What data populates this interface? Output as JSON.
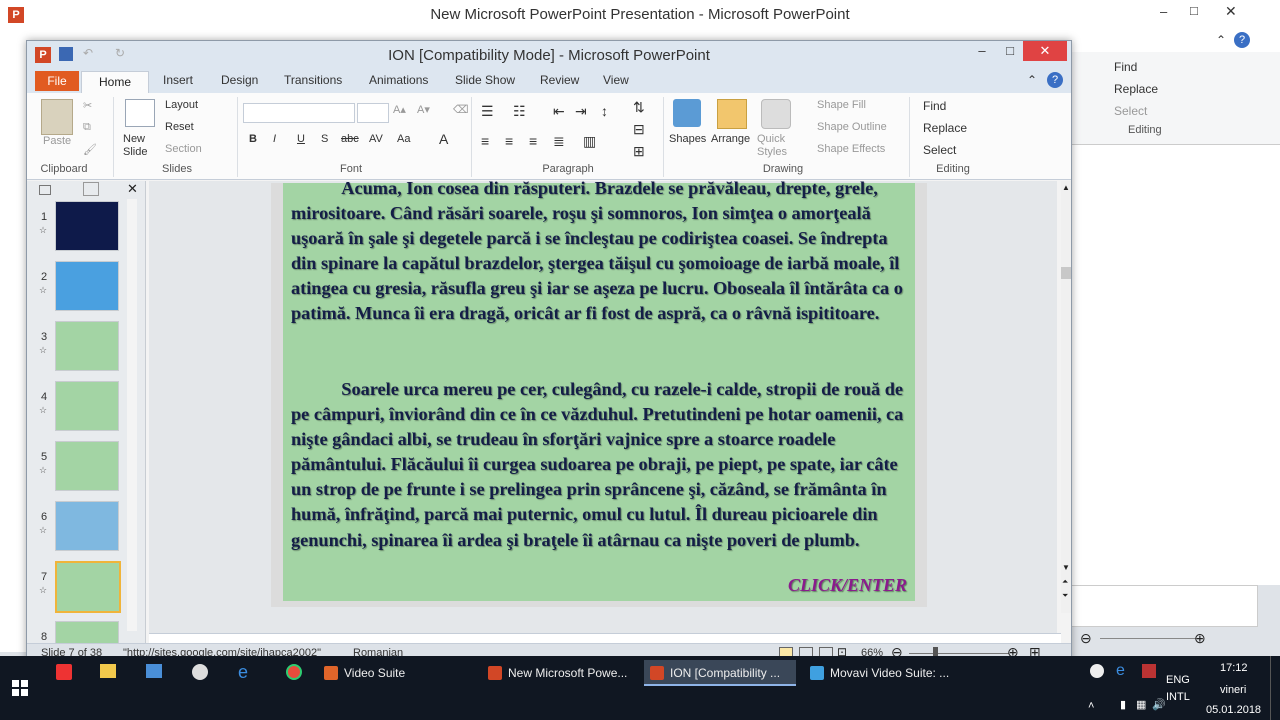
{
  "background_window": {
    "title": "New Microsoft PowerPoint Presentation  -  Microsoft PowerPoint",
    "file_tab": "File",
    "home_tab": "Home",
    "editing_group": {
      "find": "Find",
      "replace": "Replace",
      "select": "Select",
      "label": "Editing"
    }
  },
  "window": {
    "title": "ION [Compatibility Mode]  -  Microsoft PowerPoint",
    "controls": {
      "minimize": "–",
      "maximize": "□",
      "close": "✕"
    }
  },
  "tabs": [
    "File",
    "Home",
    "Insert",
    "Design",
    "Transitions",
    "Animations",
    "Slide Show",
    "Review",
    "View"
  ],
  "ribbon": {
    "clipboard": {
      "paste": "Paste",
      "label": "Clipboard"
    },
    "slides": {
      "new_slide": "New Slide",
      "layout": "Layout",
      "reset": "Reset",
      "section": "Section",
      "label": "Slides"
    },
    "font": {
      "bold": "B",
      "italic": "I",
      "underline": "U",
      "shadow": "S",
      "strike": "abc",
      "spacing": "AV",
      "case": "Aa",
      "color": "A",
      "label": "Font"
    },
    "paragraph": {
      "label": "Paragraph"
    },
    "drawing": {
      "shapes": "Shapes",
      "arrange": "Arrange",
      "quick_styles": "Quick Styles",
      "shape_fill": "Shape Fill",
      "shape_outline": "Shape Outline",
      "shape_effects": "Shape Effects",
      "label": "Drawing"
    },
    "editing": {
      "find": "Find",
      "replace": "Replace",
      "select": "Select",
      "label": "Editing"
    }
  },
  "slides": [
    {
      "number": "1",
      "color": "#0e1a4a"
    },
    {
      "number": "2",
      "color": "#4aa0e0"
    },
    {
      "number": "3",
      "color": "#a3d4a4"
    },
    {
      "number": "4",
      "color": "#a3d4a4"
    },
    {
      "number": "5",
      "color": "#a3d4a4"
    },
    {
      "number": "6",
      "color": "#7fb8e0"
    },
    {
      "number": "7",
      "color": "#a3d4a4"
    },
    {
      "number": "8",
      "color": "#a3d4a4"
    }
  ],
  "slide_text": {
    "paragraph1": "           Acuma, Ion cosea din răsputeri. Brazdele se prăvăleau, drepte, grele, mirositoare. Când răsări soarele, roşu şi somnoros, Ion simţea o amorţeală uşoară în şale şi degetele parcă i se încleştau pe codiriştea coasei. Se îndrepta din spinare la capătul brazdelor, ştergea tăişul cu şomoioage de iarbă moale, îl atingea cu gresia, răsufla greu şi iar se aşeza pe lucru. Oboseala îl întărâta ca o patimă. Munca îi era dragă, oricât ar fi fost de aspră, ca o râvnă ispititoare.",
    "paragraph2": "           Soarele urca mereu pe cer, culegând, cu razele-i calde, stropii de rouă de pe câmpuri, înviorând din ce în ce văzduhul. Pretutindeni pe hotar oamenii, ca nişte gândaci albi, se trudeau în sforţări vajnice spre a stoarce roadele pământului. Flăcăului îi curgea sudoarea pe obraji, pe piept, pe spate, iar câte un strop de pe frunte i se prelingea prin sprâncene şi, căzând, se frământa în humă, înfrăţind, parcă mai puternic, omul cu lutul. Îl dureau picioarele din genunchi, spinarea îi ardea şi braţele îi atârnau ca nişte poveri de plumb.",
    "click_enter": "CLICK/ENTER"
  },
  "status": {
    "slide_info": "Slide 7 of 38",
    "theme": "\"http://sites.google.com/site/ihapca2002\"",
    "language": "Romanian",
    "zoom": "66%"
  },
  "taskbar": {
    "tasks": [
      {
        "label": "Video Suite",
        "color": "#e0652a"
      },
      {
        "label": "New Microsoft Powe...",
        "color": "#d24726"
      },
      {
        "label": "ION [Compatibility ...",
        "color": "#d24726"
      },
      {
        "label": "Movavi Video Suite: ...",
        "color": "#3fa0e0"
      }
    ],
    "lang": "ENG",
    "layout": "INTL",
    "time": "17:12",
    "day": "vineri",
    "date": "05.01.2018"
  }
}
